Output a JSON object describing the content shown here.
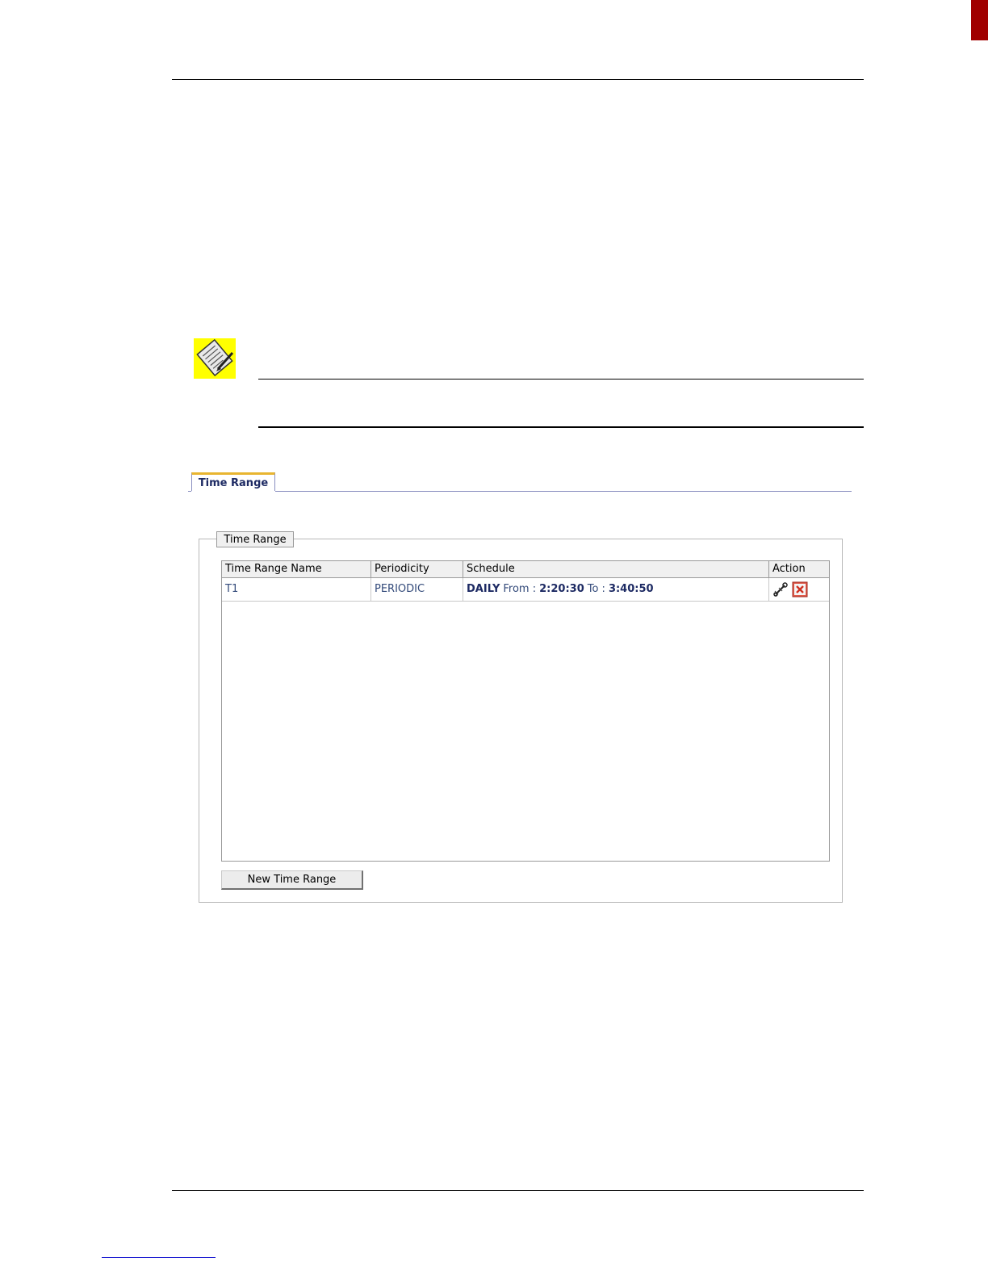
{
  "tabs": [
    {
      "label": "Time Range"
    }
  ],
  "panel": {
    "legend": "Time Range"
  },
  "table": {
    "headers": [
      "Time Range Name",
      "Periodicity",
      "Schedule",
      "Action"
    ],
    "rows": [
      {
        "name": "T1",
        "periodicity": "PERIODIC",
        "schedule": {
          "frequency": "DAILY",
          "from_label": "From :",
          "from_time": "2:20:30",
          "to_label": "To :",
          "to_time": "3:40:50"
        },
        "actions": [
          "edit-icon",
          "delete-icon"
        ]
      }
    ]
  },
  "buttons": {
    "new_time_range": "New Time Range"
  },
  "colors": {
    "accent": "#e8b530",
    "text_blue": "#1d2a63",
    "delete_red": "#e05a4a"
  }
}
